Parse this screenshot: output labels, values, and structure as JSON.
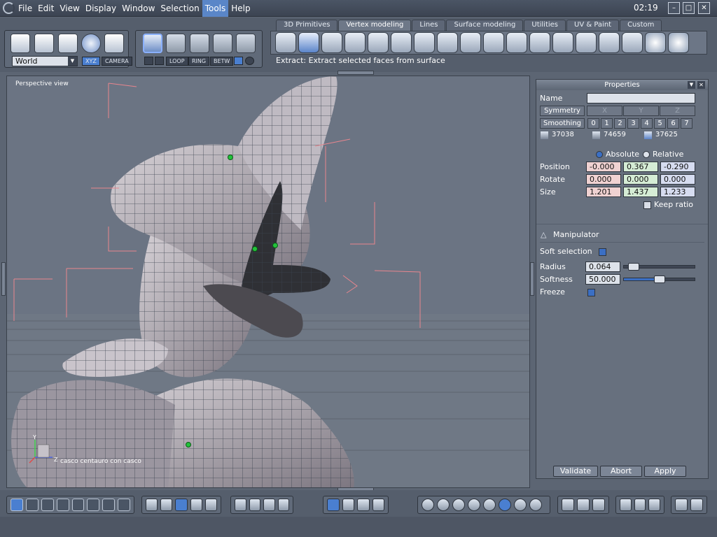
{
  "menubar": {
    "items": [
      "File",
      "Edit",
      "View",
      "Display",
      "Window",
      "Selection",
      "Tools",
      "Help"
    ],
    "active": "Tools",
    "clock": "02:19"
  },
  "toolbar": {
    "coordinate_space": "World",
    "xyz_label": "XYZ",
    "camera_label": "CAMERA",
    "loop_label": "LOOP",
    "ring_label": "RING",
    "betw_label": "BETW",
    "tabs": [
      "3D Primitives",
      "Vertex modeling",
      "Lines",
      "Surface modeling",
      "Utilities",
      "UV & Paint",
      "Custom"
    ],
    "active_tab": "Vertex modeling",
    "status_text": "Extract: Extract selected faces from surface"
  },
  "viewport": {
    "title": "Perspective view",
    "object_label": "casco centauro con casco",
    "axis_y": "Y",
    "axis_z": "Z"
  },
  "properties": {
    "header": "Properties",
    "name_label": "Name",
    "name_value": "",
    "symmetry_label": "Symmetry",
    "sym_axes": [
      "X",
      "Y",
      "Z"
    ],
    "smoothing_label": "Smoothing",
    "smoothing_levels": [
      "0",
      "1",
      "2",
      "3",
      "4",
      "5",
      "6",
      "7"
    ],
    "counts": [
      "37038",
      "74659",
      "37625"
    ],
    "absolute_label": "Absolute",
    "relative_label": "Relative",
    "mode": "Absolute",
    "position_label": "Position",
    "position": [
      "-0.000",
      "0.367",
      "-0.290"
    ],
    "rotate_label": "Rotate",
    "rotate": [
      "0.000",
      "0.000",
      "0.000"
    ],
    "size_label": "Size",
    "size": [
      "1.201",
      "1.437",
      "1.233"
    ],
    "keep_ratio_label": "Keep ratio",
    "manipulator_label": "Manipulator",
    "soft_selection_label": "Soft selection",
    "radius_label": "Radius",
    "radius_value": "0.064",
    "radius_fraction": 0.08,
    "softness_label": "Softness",
    "softness_value": "50.000",
    "softness_fraction": 0.5,
    "freeze_label": "Freeze",
    "validate_label": "Validate",
    "abort_label": "Abort",
    "apply_label": "Apply"
  }
}
